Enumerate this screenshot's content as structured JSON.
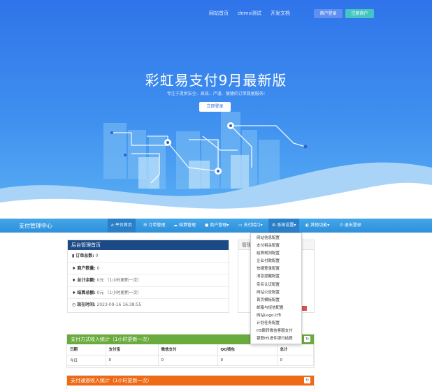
{
  "hero": {
    "nav": [
      "网站首页",
      "demo测试",
      "开发文档"
    ],
    "login": "商户登录",
    "register": "注册商户",
    "title": "彩虹易支付9月最新版",
    "subtitle": "专注于提供安全、高效、严谨、便捷的订单数据服务!",
    "cta": "立即登录"
  },
  "admin": {
    "brand": "支付管理中心",
    "menu": [
      {
        "icon": "home-icon",
        "glyph": "⌂",
        "label": "平台首页"
      },
      {
        "icon": "list-icon",
        "glyph": "☰",
        "label": "订单管理"
      },
      {
        "icon": "cloud-icon",
        "glyph": "☁",
        "label": "结算管理"
      },
      {
        "icon": "user-icon",
        "glyph": "●",
        "label": "商户管理▾"
      },
      {
        "icon": "card-icon",
        "glyph": "▭",
        "label": "支付接口▾"
      },
      {
        "icon": "gear-icon",
        "glyph": "⚙",
        "label": "系统设置▾"
      },
      {
        "icon": "globe-icon",
        "glyph": "◐",
        "label": "其他功能▾"
      },
      {
        "icon": "power-icon",
        "glyph": "⏻",
        "label": "退出登录"
      }
    ]
  },
  "dashboard": {
    "title": "后台管理首页",
    "rows": [
      {
        "icon": "bar-chart-icon",
        "glyph": "▮",
        "label": "订单总数:",
        "value": "0",
        "note": ""
      },
      {
        "icon": "drop-icon",
        "glyph": "♦",
        "label": "商户数量:",
        "value": "0",
        "note": ""
      },
      {
        "icon": "drop-icon",
        "glyph": "♦",
        "label": "总计余额:",
        "value": "0元",
        "note": "（1小时更新一次）"
      },
      {
        "icon": "drop-icon",
        "glyph": "♦",
        "label": "结算总额:",
        "value": "0元",
        "note": "（1小时更新一次）"
      },
      {
        "icon": "clock-icon",
        "glyph": "◷",
        "label": "现在时间:",
        "value": "2023-09-16 16:38:55",
        "note": ""
      }
    ]
  },
  "side_panel": {
    "title": "管理"
  },
  "dropdown": [
    "网站信息配置",
    "支付相关配置",
    "结算规则配置",
    "企业付款配置",
    "快捷登录配置",
    "消息提醒配置",
    "实名认证配置",
    "网站公告配置",
    "首页模板配置",
    "邮箱与短信配置",
    "网站Logo上传",
    "计划任务配置",
    "H5跳转微信客服支付",
    "银联H5进件银行结算"
  ],
  "income_table": {
    "title": "支付方式收入统计（1小时更新一次）",
    "header_color": "#6aab3e",
    "headers": [
      "日期",
      "支付宝",
      "微信支付",
      "QQ钱包",
      "总计"
    ],
    "rows": [
      [
        "今日",
        "0",
        "0",
        "0",
        "0"
      ]
    ]
  },
  "channel_table": {
    "title": "支付通道收入统计（1小时更新一次）",
    "header_color": "#ee6a16"
  },
  "colors": {
    "primary": "#2f74ea",
    "bar": "#3a9be2",
    "dark_header": "#1b4a86"
  }
}
